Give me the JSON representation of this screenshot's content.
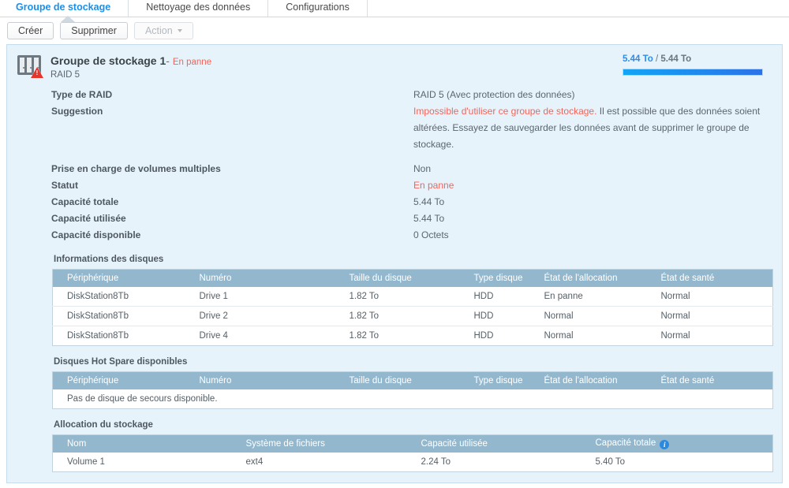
{
  "tabs": [
    {
      "label": "Groupe de stockage",
      "active": true
    },
    {
      "label": "Nettoyage des données",
      "active": false
    },
    {
      "label": "Configurations",
      "active": false
    }
  ],
  "toolbar": {
    "create_label": "Créer",
    "delete_label": "Supprimer",
    "action_label": "Action"
  },
  "pool": {
    "title": "Groupe de stockage 1",
    "separator": "-",
    "state": "En panne",
    "subtitle": "RAID 5",
    "capacity_used": "5.44 To",
    "capacity_slash": "/",
    "capacity_total": "5.44 To",
    "capacity_percent": 100
  },
  "details": [
    {
      "label": "Type de RAID",
      "value": "RAID 5 (Avec protection des données)",
      "style": "normal"
    },
    {
      "label": "Suggestion",
      "value_red": "Impossible d'utiliser ce groupe de stockage.",
      "value_rest": " Il est possible que des données soient altérées. Essayez de sauvegarder les données avant de supprimer le groupe de stockage.",
      "style": "mixed"
    },
    {
      "label": "Prise en charge de volumes multiples",
      "value": "Non",
      "style": "normal"
    },
    {
      "label": "Statut",
      "value": "En panne",
      "style": "error"
    },
    {
      "label": "Capacité totale",
      "value": "5.44 To",
      "style": "normal"
    },
    {
      "label": "Capacité utilisée",
      "value": "5.44 To",
      "style": "normal"
    },
    {
      "label": "Capacité disponible",
      "value": "0 Octets",
      "style": "normal"
    }
  ],
  "disks_section": {
    "title": "Informations des disques",
    "columns": [
      "Périphérique",
      "Numéro",
      "Taille du disque",
      "Type disque",
      "État de l'allocation",
      "État de santé"
    ],
    "rows": [
      {
        "device": "DiskStation8Tb",
        "number": "Drive 1",
        "size": "1.82 To",
        "type": "HDD",
        "allocation": "En panne",
        "allocation_state": "error",
        "health": "Normal",
        "health_state": "ok"
      },
      {
        "device": "DiskStation8Tb",
        "number": "Drive 2",
        "size": "1.82 To",
        "type": "HDD",
        "allocation": "Normal",
        "allocation_state": "ok",
        "health": "Normal",
        "health_state": "ok"
      },
      {
        "device": "DiskStation8Tb",
        "number": "Drive 4",
        "size": "1.82 To",
        "type": "HDD",
        "allocation": "Normal",
        "allocation_state": "ok",
        "health": "Normal",
        "health_state": "ok"
      }
    ]
  },
  "hotspare_section": {
    "title": "Disques Hot Spare disponibles",
    "columns": [
      "Périphérique",
      "Numéro",
      "Taille du disque",
      "Type disque",
      "État de l'allocation",
      "État de santé"
    ],
    "empty_message": "Pas de disque de secours disponible."
  },
  "allocation_section": {
    "title": "Allocation du stockage",
    "columns": [
      "Nom",
      "Système de fichiers",
      "Capacité utilisée",
      "Capacité totale"
    ],
    "info_icon": "info-icon",
    "rows": [
      {
        "name": "Volume 1",
        "filesystem": "ext4",
        "used": "2.24 To",
        "total": "5.40 To"
      }
    ]
  },
  "colors": {
    "accent_blue": "#1890ed",
    "error_red": "#f4645a",
    "ok_green": "#2aa22a",
    "panel_bg": "#e6f3fb",
    "table_header": "#93b8ce"
  }
}
